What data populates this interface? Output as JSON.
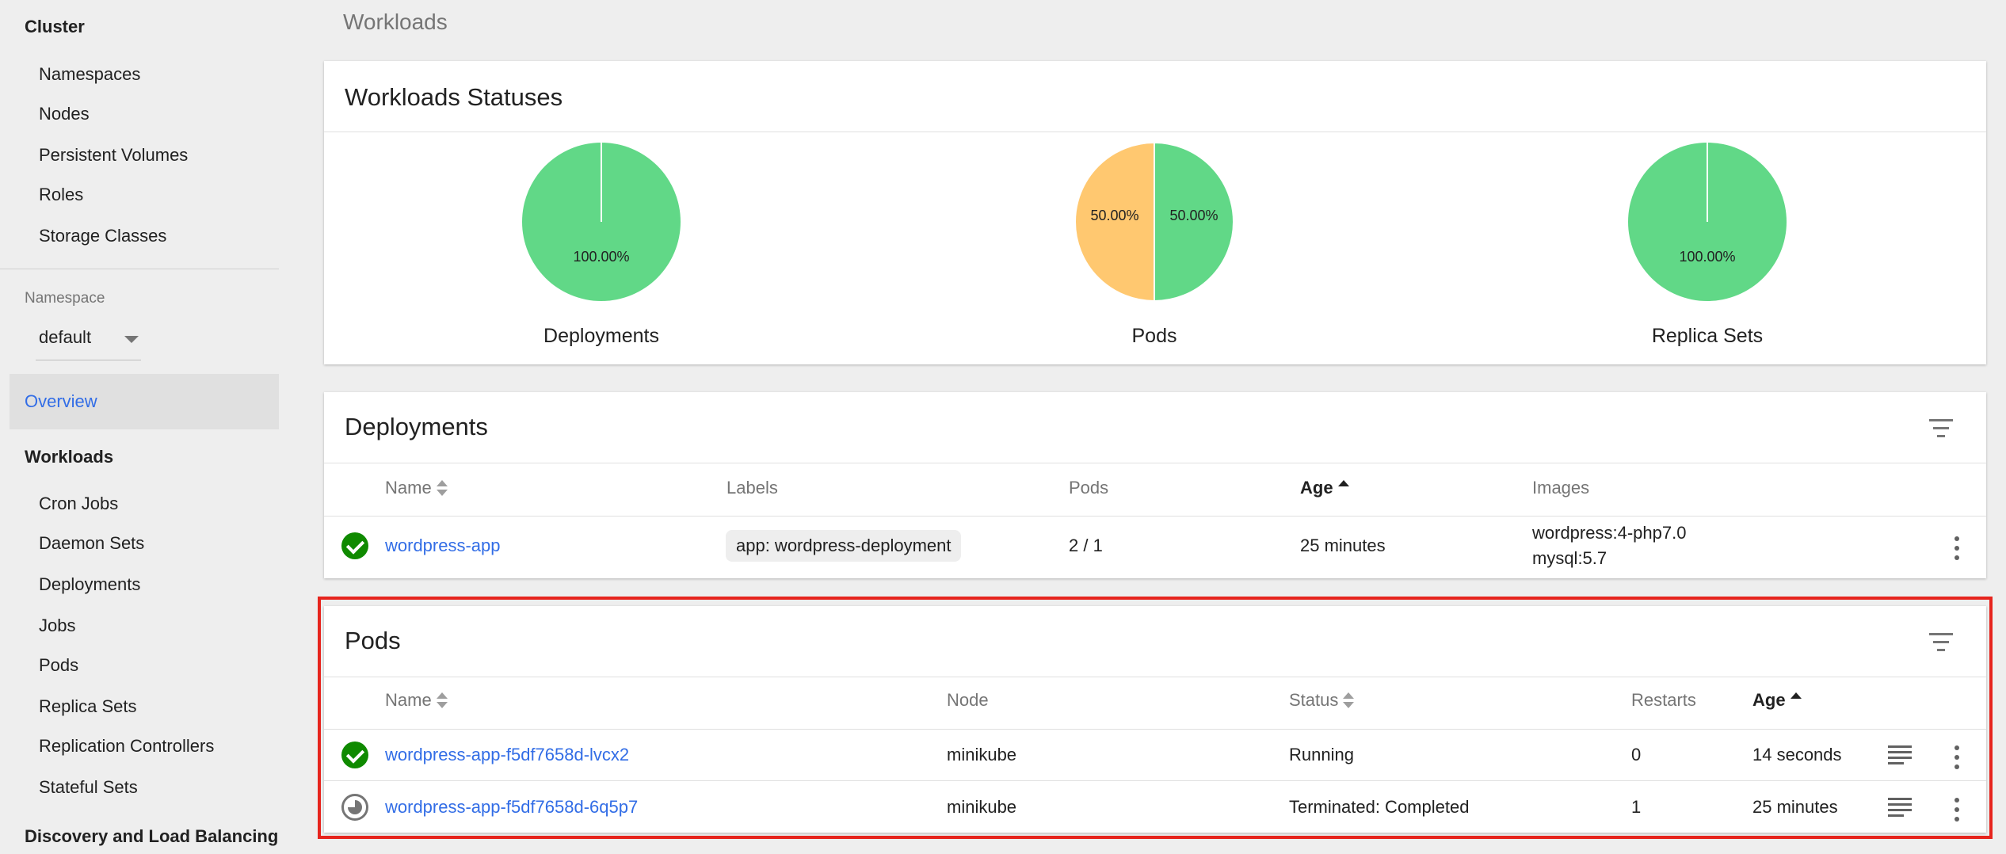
{
  "sidebar": {
    "cluster_heading": "Cluster",
    "cluster_items": [
      "Namespaces",
      "Nodes",
      "Persistent Volumes",
      "Roles",
      "Storage Classes"
    ],
    "namespace_label": "Namespace",
    "namespace_value": "default",
    "overview": "Overview",
    "workloads_heading": "Workloads",
    "workloads_items": [
      "Cron Jobs",
      "Daemon Sets",
      "Deployments",
      "Jobs",
      "Pods",
      "Replica Sets",
      "Replication Controllers",
      "Stateful Sets"
    ],
    "discovery_heading": "Discovery and Load Balancing"
  },
  "page_title": "Workloads",
  "statuses": {
    "title": "Workloads Statuses",
    "charts": [
      {
        "label": "Deployments",
        "slices": [
          {
            "value": 100,
            "text": "100.00%",
            "color": "#61d887"
          }
        ]
      },
      {
        "label": "Pods",
        "slices": [
          {
            "value": 50,
            "text": "50.00%",
            "color": "#61d887"
          },
          {
            "value": 50,
            "text": "50.00%",
            "color": "#ffc870"
          }
        ]
      },
      {
        "label": "Replica Sets",
        "slices": [
          {
            "value": 100,
            "text": "100.00%",
            "color": "#61d887"
          }
        ]
      }
    ]
  },
  "deployments": {
    "title": "Deployments",
    "columns": {
      "name": "Name",
      "labels": "Labels",
      "pods": "Pods",
      "age": "Age",
      "images": "Images"
    },
    "rows": [
      {
        "name": "wordpress-app",
        "label": "app: wordpress-deployment",
        "pods": "2 / 1",
        "age": "25 minutes",
        "images": [
          "wordpress:4-php7.0",
          "mysql:5.7"
        ]
      }
    ]
  },
  "pods": {
    "title": "Pods",
    "columns": {
      "name": "Name",
      "node": "Node",
      "status": "Status",
      "restarts": "Restarts",
      "age": "Age"
    },
    "rows": [
      {
        "name": "wordpress-app-f5df7658d-lvcx2",
        "node": "minikube",
        "status": "Running",
        "restarts": "0",
        "age": "14 seconds",
        "icon": "check-circle-icon"
      },
      {
        "name": "wordpress-app-f5df7658d-6q5p7",
        "node": "minikube",
        "status": "Terminated: Completed",
        "restarts": "1",
        "age": "25 minutes",
        "icon": "terminated-icon"
      }
    ]
  },
  "colors": {
    "accent": "#326de6",
    "success": "#0f8a00",
    "pie_green": "#61d887",
    "pie_orange": "#ffc870",
    "highlight": "#e6241d"
  }
}
